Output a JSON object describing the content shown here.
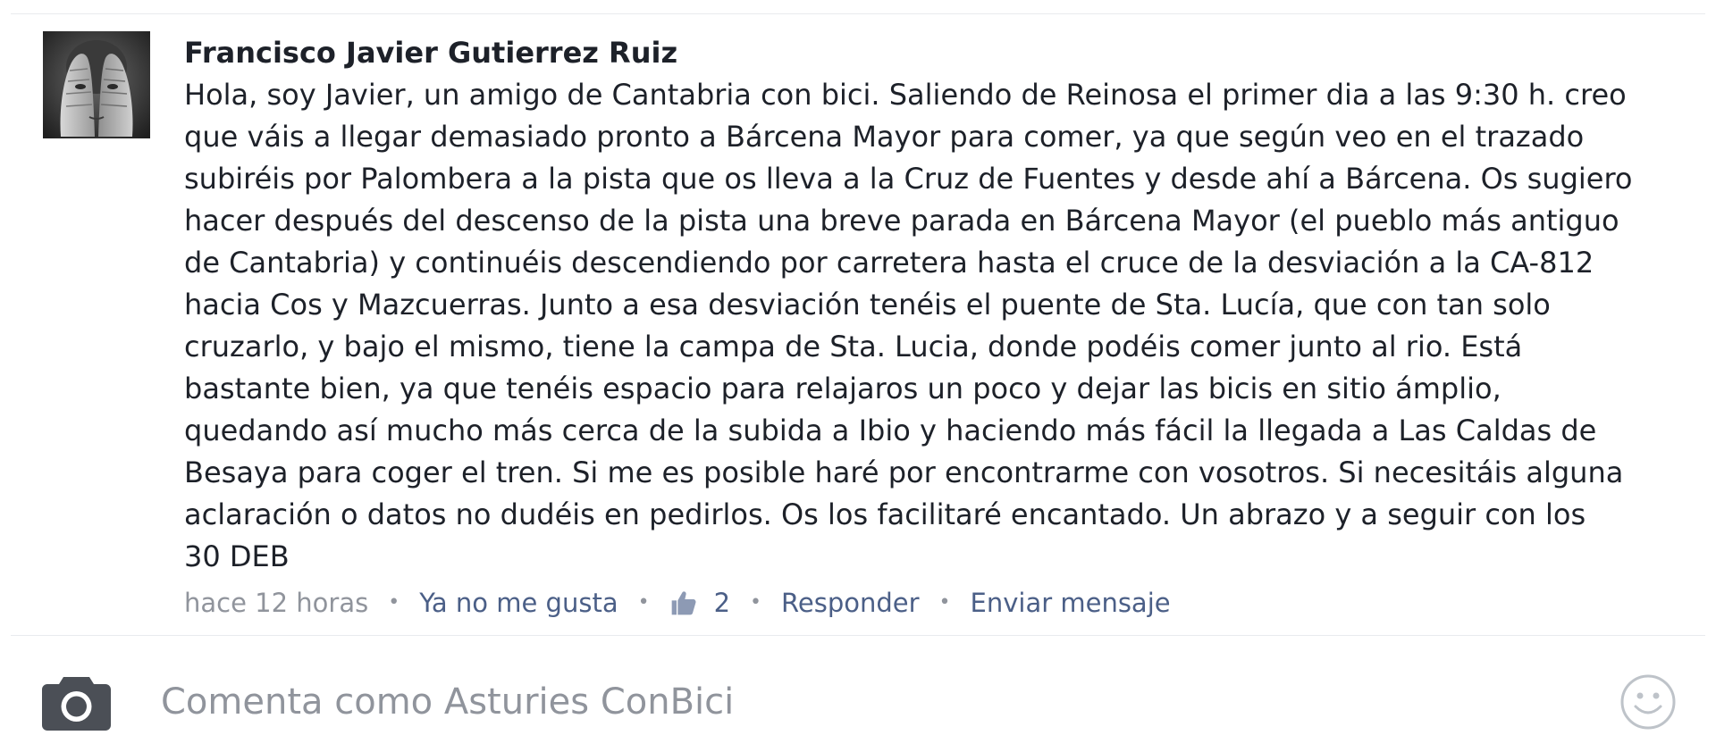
{
  "comment": {
    "author": "Francisco Javier Gutierrez Ruiz",
    "avatar_icon": "avatar-photo-hands-over-face",
    "text_lines": [
      "Hola, soy Javier, un amigo de Cantabria con bici. Saliendo de Reinosa el primer dia a las 9:30 h. creo",
      "que váis a llegar demasiado pronto a Bárcena Mayor para comer, ya que según veo en el trazado",
      "subiréis por Palombera a la pista que os lleva a la Cruz de Fuentes y desde ahí a Bárcena. Os sugiero",
      "hacer después del descenso de la pista una breve parada en Bárcena Mayor (el pueblo más antiguo",
      "de Cantabria) y continuéis descendiendo por carretera hasta el cruce de la desviación a la CA-812",
      "hacia Cos y Mazcuerras. Junto a esa desviación tenéis el puente de Sta. Lucía, que con tan solo",
      "cruzarlo, y bajo el mismo, tiene la campa de Sta. Lucia, donde podéis comer junto al rio. Está",
      "bastante bien, ya que tenéis espacio para relajaros un poco y dejar las bicis en sitio ámplio,",
      "quedando así mucho más cerca de la subida a Ibio y haciendo más fácil la llegada a Las Caldas de",
      "Besaya para coger el tren. Si me es posible haré por encontrarme con vosotros. Si necesitáis alguna",
      "aclaración o datos no dudéis en pedirlos. Os los facilitaré encantado. Un abrazo y a seguir con los",
      "30 DEB"
    ],
    "time": "hace 12 horas",
    "separator": "•",
    "unlike_label": "Ya no me gusta",
    "like_icon": "thumbs-up-icon",
    "like_count": "2",
    "reply_label": "Responder",
    "message_label": "Enviar mensaje"
  },
  "composer": {
    "camera_icon": "camera-icon",
    "placeholder": "Comenta como Asturies ConBici",
    "emoji_icon": "smiley-icon"
  },
  "colors": {
    "text": "#1d2129",
    "muted": "#90949c",
    "link": "#4b5f87",
    "icon": "#4b4f56",
    "divider": "#e9ebee"
  }
}
